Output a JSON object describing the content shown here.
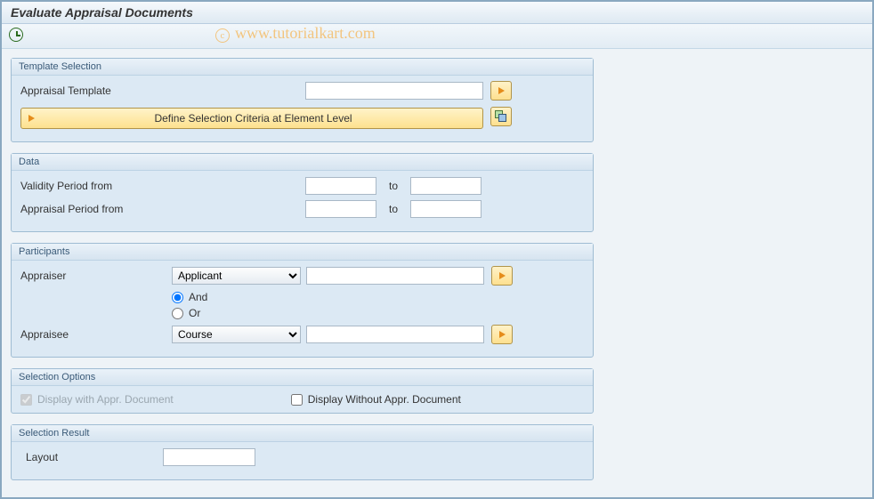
{
  "watermark": "www.tutorialkart.com",
  "title": "Evaluate Appraisal Documents",
  "groups": {
    "template": {
      "header": "Template Selection",
      "appraisal_template_label": "Appraisal Template",
      "define_criteria_label": "Define Selection Criteria at Element Level"
    },
    "data": {
      "header": "Data",
      "validity_label": "Validity Period from",
      "appraisal_label": "Appraisal Period from",
      "to_label": "to"
    },
    "participants": {
      "header": "Participants",
      "appraiser_label": "Appraiser",
      "appraiser_select": "Applicant",
      "and_label": "And",
      "or_label": "Or",
      "appraisee_label": "Appraisee",
      "appraisee_select": "Course"
    },
    "options": {
      "header": "Selection Options",
      "display_with_label": "Display with Appr. Document",
      "display_without_label": "Display Without Appr. Document"
    },
    "result": {
      "header": "Selection Result",
      "layout_label": "Layout"
    }
  }
}
